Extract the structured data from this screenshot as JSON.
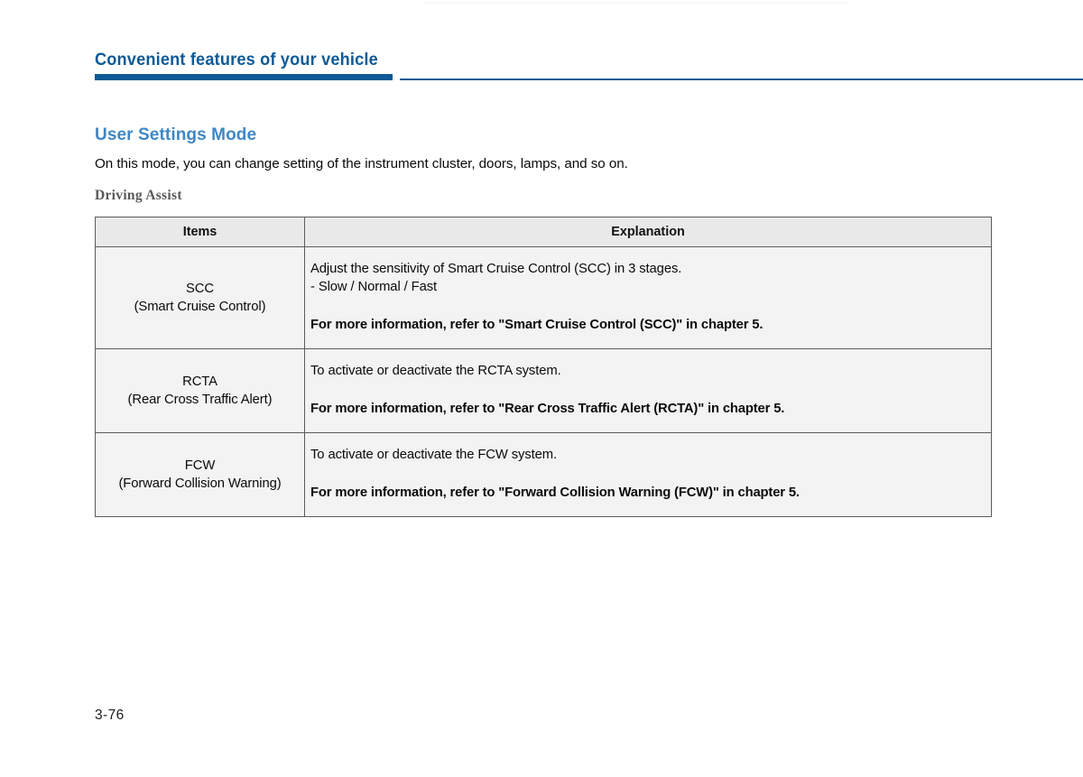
{
  "header": {
    "title": "Convenient features of your vehicle"
  },
  "section": {
    "title": "User Settings Mode",
    "intro": "On this mode, you can change setting of the instrument cluster, doors, lamps, and so on.",
    "sub_heading": "Driving Assist"
  },
  "table": {
    "columns": [
      "Items",
      "Explanation"
    ],
    "rows": [
      {
        "item_abbr": "SCC",
        "item_full": "(Smart Cruise Control)",
        "explanation_lines": [
          "Adjust the sensitivity of Smart Cruise Control (SCC) in 3 stages.",
          "- Slow / Normal / Fast"
        ],
        "explanation_note": "For more information, refer to \"Smart Cruise Control (SCC)\" in chapter 5."
      },
      {
        "item_abbr": "RCTA",
        "item_full": "(Rear Cross Traffic Alert)",
        "explanation_lines": [
          "To activate or deactivate the RCTA system."
        ],
        "explanation_note": "For more information, refer to \"Rear Cross Traffic Alert (RCTA)\" in chapter 5."
      },
      {
        "item_abbr": "FCW",
        "item_full": "(Forward Collision Warning)",
        "explanation_lines": [
          "To activate or deactivate the FCW system."
        ],
        "explanation_note": "For more information, refer to \"Forward Collision Warning (FCW)\" in chapter 5."
      }
    ]
  },
  "footer": {
    "page_number": "3-76"
  },
  "colors": {
    "header_blue": "#0d5a96",
    "section_blue": "#3f87c4",
    "table_border": "#5c5c5c",
    "table_header_bg": "#e9e9e9",
    "table_cell_bg": "#f3f3f3"
  }
}
